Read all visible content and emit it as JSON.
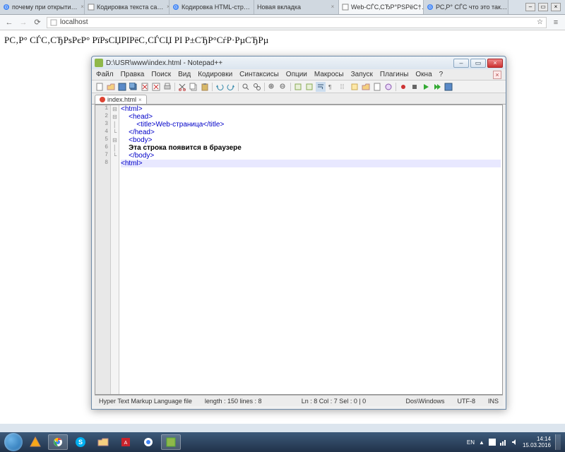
{
  "browser": {
    "tabs": [
      {
        "label": "почему при открыти…",
        "favicon": "g"
      },
      {
        "label": "Кодировка текста са…",
        "favicon": "doc"
      },
      {
        "label": "Кодировка HTML-стр…",
        "favicon": "g"
      },
      {
        "label": "Новая вкладка",
        "favicon": ""
      },
      {
        "label": "Web-СЃС‚СЂР°РЅРёС†…",
        "favicon": "doc",
        "active": true
      },
      {
        "label": "РС‚Р° СЃС что это так…",
        "favicon": "g"
      }
    ],
    "url": "localhost",
    "nav": {
      "back": "←",
      "forward": "→",
      "reload": "⟳",
      "star": "☆",
      "menu": "≡"
    }
  },
  "page_text": "РС‚Р° СЃС‚СЂРѕРєР° РїРѕСЏРІРёС‚СЃСЏ РІ Р±СЂР°СѓР·РµСЂРµ",
  "notepad": {
    "title": "D:\\USR\\www\\index.html - Notepad++",
    "menus": [
      "Файл",
      "Правка",
      "Поиск",
      "Вид",
      "Кодировки",
      "Синтаксисы",
      "Опции",
      "Макросы",
      "Запуск",
      "Плагины",
      "Окна",
      "?"
    ],
    "filetab": {
      "name": "index.html",
      "close": "×"
    },
    "code_lines": [
      "<html>",
      "    <head>",
      "        <title>Web-страница</title>",
      "    </head>",
      "    <body>",
      "    Эта строка появится в браузере",
      "    </body>",
      "<html>"
    ],
    "line_numbers": [
      "1",
      "2",
      "3",
      "4",
      "5",
      "6",
      "7",
      "8"
    ],
    "status": {
      "lang": "Hyper Text Markup Language file",
      "length": "length : 150    lines : 8",
      "pos": "Ln : 8    Col : 7    Sel : 0 | 0",
      "eol": "Dos\\Windows",
      "enc": "UTF-8",
      "mode": "INS"
    },
    "winbtns": {
      "min": "–",
      "max": "▭",
      "close": "×"
    }
  },
  "taskbar": {
    "lang": "EN",
    "time": "14:14",
    "date": "15.03.2016",
    "tray_up": "▲"
  }
}
